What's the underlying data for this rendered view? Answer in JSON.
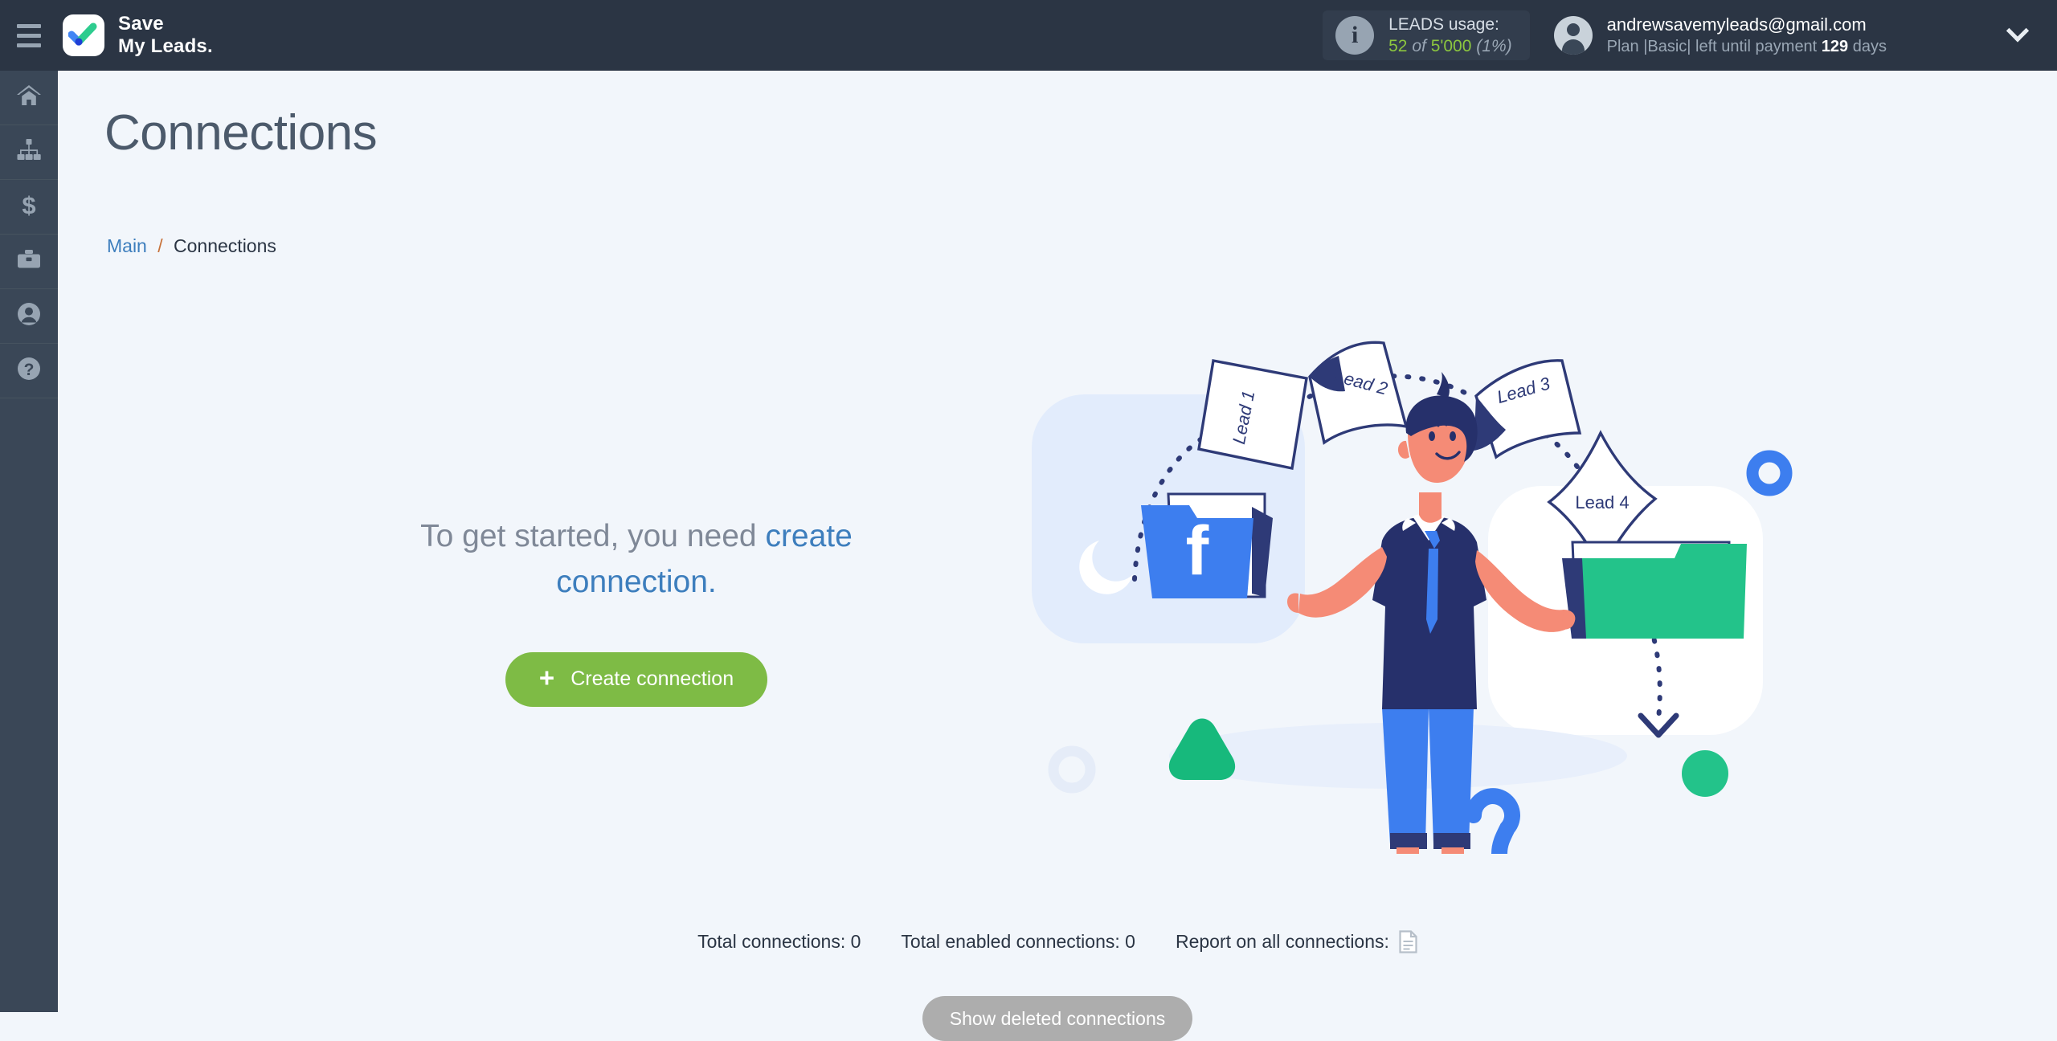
{
  "header": {
    "menu_icon": "hamburger-icon",
    "brand": {
      "line1": "Save",
      "line2": "My Leads.",
      "logo_icon": "check-logo-icon"
    },
    "usage": {
      "icon": "info-icon",
      "title": "LEADS usage:",
      "used": "52",
      "of": "of",
      "limit": "5'000",
      "percent": "(1%)"
    },
    "account": {
      "avatar_icon": "user-avatar-icon",
      "email": "andrewsavemyleads@gmail.com",
      "plan_prefix": "Plan |Basic| left until payment",
      "days_value": "129",
      "days_suffix": "days",
      "dropdown_icon": "chevron-down-icon"
    }
  },
  "sidebar": {
    "items": [
      {
        "name": "home",
        "icon": "home-icon"
      },
      {
        "name": "connections",
        "icon": "sitemap-icon"
      },
      {
        "name": "billing",
        "icon": "dollar-icon"
      },
      {
        "name": "services",
        "icon": "briefcase-icon"
      },
      {
        "name": "profile",
        "icon": "user-icon"
      },
      {
        "name": "help",
        "icon": "question-circle-icon"
      }
    ]
  },
  "main": {
    "title": "Connections",
    "breadcrumb": {
      "root": "Main",
      "separator": "/",
      "current": "Connections"
    },
    "cta": {
      "text_plain": "To get started, you need ",
      "text_link": "create connection.",
      "button_icon": "plus-icon",
      "button_label": "Create connection"
    },
    "illustration": {
      "leads": [
        "Lead 1",
        "Lead 2",
        "Lead 3",
        "Lead 4"
      ],
      "source_icon": "facebook-folder-icon",
      "target_icon": "green-folder-icon",
      "character": "person-shrugging"
    },
    "stats": {
      "total_connections_label": "Total connections:",
      "total_connections_value": "0",
      "total_enabled_label": "Total enabled connections:",
      "total_enabled_value": "0",
      "report_label": "Report on all connections:",
      "report_icon": "document-icon"
    },
    "deleted_button_label": "Show deleted connections"
  },
  "colors": {
    "header_bg": "#2b3544",
    "sidebar_bg": "#3a4757",
    "content_bg": "#f2f6fb",
    "accent_green": "#7ebb45",
    "link_blue": "#3d7ebd",
    "usage_green": "#8cc63f",
    "muted_gray": "#adadad"
  }
}
